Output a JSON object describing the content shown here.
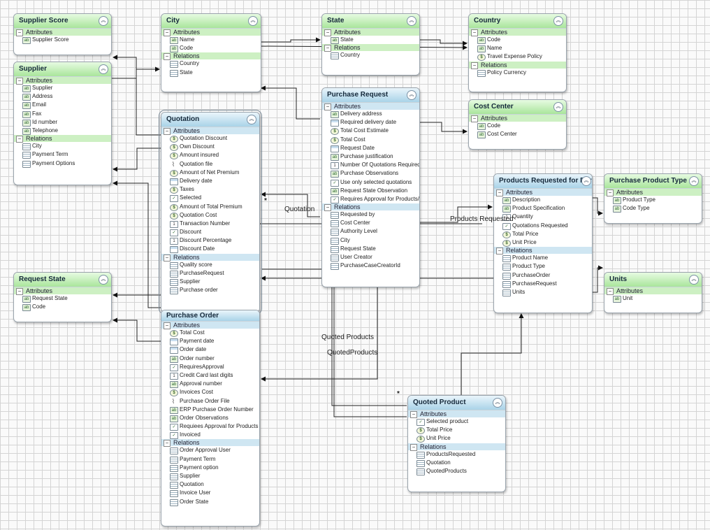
{
  "entities": {
    "supplier_score": {
      "title": "Supplier Score",
      "attr_label": "Attributes",
      "attributes": [
        {
          "name": "Supplier Score",
          "icon": "text-icon"
        }
      ]
    },
    "supplier": {
      "title": "Supplier",
      "attr_label": "Attributes",
      "attributes": [
        {
          "name": "Supplier",
          "icon": "text-icon"
        },
        {
          "name": "Address",
          "icon": "text-icon"
        },
        {
          "name": "Email",
          "icon": "text-icon"
        },
        {
          "name": "Fax",
          "icon": "text-icon"
        },
        {
          "name": "Id number",
          "icon": "text-icon"
        },
        {
          "name": "Telephone",
          "icon": "text-icon"
        }
      ],
      "rel_label": "Relations",
      "relations": [
        {
          "name": "City"
        },
        {
          "name": "Payment Term"
        },
        {
          "name": "Payment Options"
        }
      ]
    },
    "city": {
      "title": "City",
      "attr_label": "Attributes",
      "attributes": [
        {
          "name": "Name",
          "icon": "text-icon"
        },
        {
          "name": "Code",
          "icon": "text-icon"
        }
      ],
      "rel_label": "Relations",
      "relations": [
        {
          "name": "Country"
        },
        {
          "name": "State"
        }
      ]
    },
    "state": {
      "title": "State",
      "attr_label": "Attributes",
      "attributes": [
        {
          "name": "State",
          "icon": "text-icon"
        }
      ],
      "rel_label": "Relations",
      "relations": [
        {
          "name": "Country"
        }
      ]
    },
    "country": {
      "title": "Country",
      "attr_label": "Attributes",
      "attributes": [
        {
          "name": "Code",
          "icon": "text-icon"
        },
        {
          "name": "Name",
          "icon": "text-icon"
        },
        {
          "name": "Travel Expense Policy",
          "icon": "money-icon"
        }
      ],
      "rel_label": "Relations",
      "relations": [
        {
          "name": "Policy Currency"
        }
      ]
    },
    "cost_center": {
      "title": "Cost Center",
      "attr_label": "Attributes",
      "attributes": [
        {
          "name": "Code",
          "icon": "text-icon"
        },
        {
          "name": "Cost Center",
          "icon": "text-icon"
        }
      ]
    },
    "purchase_request": {
      "title": "Purchase Request",
      "attr_label": "Attributes",
      "attributes": [
        {
          "name": "Delivery address",
          "icon": "text-icon"
        },
        {
          "name": "Required delivery date",
          "icon": "calendar-icon"
        },
        {
          "name": "Total Cost Estimate",
          "icon": "money-icon"
        },
        {
          "name": "Total Cost",
          "icon": "money-icon"
        },
        {
          "name": "Request Date",
          "icon": "calendar-icon"
        },
        {
          "name": "Purchase justification",
          "icon": "text-icon"
        },
        {
          "name": "Number Of Quotations Required",
          "icon": "number-icon"
        },
        {
          "name": "Purchase Observations",
          "icon": "text-icon"
        },
        {
          "name": "Use only selected quotations",
          "icon": "checkbox-icon"
        },
        {
          "name": "Request State Observation",
          "icon": "text-icon"
        },
        {
          "name": "Requires Approval for Products/S",
          "icon": "checkbox-icon"
        }
      ],
      "rel_label": "Relations",
      "relations": [
        {
          "name": "Requested by"
        },
        {
          "name": "Cost Center"
        },
        {
          "name": "Authority Level"
        },
        {
          "name": "City"
        },
        {
          "name": "Request State"
        },
        {
          "name": "User Creator"
        },
        {
          "name": "PurchaseCaseCreatorId"
        }
      ]
    },
    "quotation": {
      "title": "Quotation",
      "attr_label": "Attributes",
      "attributes": [
        {
          "name": "Quotation Discount",
          "icon": "money-icon"
        },
        {
          "name": "Own Discount",
          "icon": "money-icon"
        },
        {
          "name": "Amount insured",
          "icon": "money-icon"
        },
        {
          "name": "Quotation file",
          "icon": "clip-icon"
        },
        {
          "name": "Amount of Net Premium",
          "icon": "money-icon"
        },
        {
          "name": "Delivery date",
          "icon": "calendar-icon"
        },
        {
          "name": "Taxes",
          "icon": "money-icon"
        },
        {
          "name": "Selected",
          "icon": "checkbox-icon"
        },
        {
          "name": "Amount of Total Premium",
          "icon": "money-icon"
        },
        {
          "name": "Quotation Cost",
          "icon": "money-icon"
        },
        {
          "name": "Transaction Number",
          "icon": "number-icon"
        },
        {
          "name": "Discount",
          "icon": "checkbox-icon"
        },
        {
          "name": "Discount Percentage",
          "icon": "number-icon"
        },
        {
          "name": "Discount Date",
          "icon": "calendar-icon"
        }
      ],
      "rel_label": "Relations",
      "relations": [
        {
          "name": "Quality score"
        },
        {
          "name": "PurchaseRequest"
        },
        {
          "name": "Supplier"
        },
        {
          "name": "Purchase order"
        }
      ]
    },
    "purchase_order": {
      "title": "Purchase Order",
      "attr_label": "Attributes",
      "attributes": [
        {
          "name": "Total Cost",
          "icon": "money-icon"
        },
        {
          "name": "Payment date",
          "icon": "calendar-icon"
        },
        {
          "name": "Order date",
          "icon": "calendar-icon"
        },
        {
          "name": "Order number",
          "icon": "text-icon"
        },
        {
          "name": "RequiresApproval",
          "icon": "checkbox-icon"
        },
        {
          "name": "Credit Card last digits",
          "icon": "number-icon"
        },
        {
          "name": "Approval number",
          "icon": "text-icon"
        },
        {
          "name": "Invoices Cost",
          "icon": "money-icon"
        },
        {
          "name": "Purchase Order File",
          "icon": "clip-icon"
        },
        {
          "name": "ERP Purchase Order Number",
          "icon": "text-icon"
        },
        {
          "name": "Order Observations",
          "icon": "text-icon"
        },
        {
          "name": "Requiees Approval for Products",
          "icon": "checkbox-icon"
        },
        {
          "name": "Invoiced",
          "icon": "checkbox-icon"
        }
      ],
      "rel_label": "Relations",
      "relations": [
        {
          "name": "Order Approval User"
        },
        {
          "name": "Payment Term"
        },
        {
          "name": "Payment option"
        },
        {
          "name": "Supplier"
        },
        {
          "name": "Quotation"
        },
        {
          "name": "Invoice User"
        },
        {
          "name": "Order State"
        }
      ]
    },
    "request_state": {
      "title": "Request State",
      "attr_label": "Attributes",
      "attributes": [
        {
          "name": "Request State",
          "icon": "text-icon"
        },
        {
          "name": "Code",
          "icon": "text-icon"
        }
      ]
    },
    "products_requested": {
      "title": "Products Requested for Purc",
      "attr_label": "Attributes",
      "attributes": [
        {
          "name": "Description",
          "icon": "text-icon"
        },
        {
          "name": "Product Specification",
          "icon": "text-icon"
        },
        {
          "name": "Quantity",
          "icon": "number-icon"
        },
        {
          "name": "Quotations Requested",
          "icon": "checkbox-icon"
        },
        {
          "name": "Total Price",
          "icon": "money-icon"
        },
        {
          "name": "Unit Price",
          "icon": "money-icon"
        }
      ],
      "rel_label": "Relations",
      "relations": [
        {
          "name": "Product Name"
        },
        {
          "name": "Product Type"
        },
        {
          "name": "PurchaseOrder"
        },
        {
          "name": "PurchaseRequest"
        },
        {
          "name": "Units"
        }
      ]
    },
    "purchase_product_type": {
      "title": "Purchase Product Type",
      "attr_label": "Attributes",
      "attributes": [
        {
          "name": "Product Type",
          "icon": "text-icon"
        },
        {
          "name": "Code Type",
          "icon": "text-icon"
        }
      ]
    },
    "units": {
      "title": "Units",
      "attr_label": "Attributes",
      "attributes": [
        {
          "name": "Unit",
          "icon": "text-icon"
        }
      ]
    },
    "quoted_product": {
      "title": "Quoted Product",
      "attr_label": "Attributes",
      "attributes": [
        {
          "name": "Selected product",
          "icon": "checkbox-icon"
        },
        {
          "name": "Total Price",
          "icon": "money-icon"
        },
        {
          "name": "Unit Price",
          "icon": "money-icon"
        }
      ],
      "rel_label": "Relations",
      "relations": [
        {
          "name": "ProductsRequested"
        },
        {
          "name": "Quotation"
        },
        {
          "name": "QuotedProducts"
        }
      ]
    }
  },
  "link_labels": {
    "quotation": "Quotation",
    "products_requested": "Products Requested",
    "quoted_products": "Quoted Products",
    "quotedproducts": "QuotedProducts",
    "star1": "*",
    "star2": "*"
  }
}
